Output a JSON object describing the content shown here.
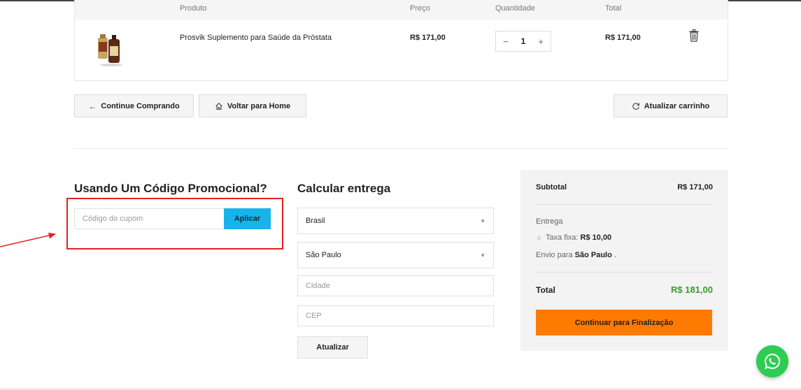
{
  "cart": {
    "headers": {
      "product": "Produto",
      "price": "Preço",
      "quantity": "Quantidade",
      "total": "Total"
    },
    "items": [
      {
        "name": "Prosvik Suplemento para Saúde da Próstata",
        "price": "R$ 171,00",
        "quantity": "1",
        "total": "R$ 171,00"
      }
    ],
    "qty_minus": "−",
    "qty_plus": "+"
  },
  "actions": {
    "continue_shopping": "Continue Comprando",
    "back_home": "Voltar para Home",
    "update_cart": "Atualizar carrinho"
  },
  "coupon": {
    "heading": "Usando Um Código Promocional?",
    "placeholder": "Código do cupom",
    "apply_label": "Aplicar"
  },
  "shipping_calc": {
    "heading": "Calcular entrega",
    "country": "Brasil",
    "state": "São Paulo",
    "city_placeholder": "Cidade",
    "zip_placeholder": "CEP",
    "update_label": "Atualizar"
  },
  "summary": {
    "subtotal_label": "Subtotal",
    "subtotal_value": "R$ 171,00",
    "shipping_label": "Entrega",
    "flat_rate_label": "Taxa fixa:",
    "flat_rate_value": "R$ 10,00",
    "ship_to_prefix": "Envio para",
    "ship_to_place": "São Paulo",
    "ship_to_suffix": ".",
    "total_label": "Total",
    "total_value": "R$ 181,00",
    "checkout_label": "Continuar para Finalização"
  },
  "colors": {
    "accent_blue": "#16b4e9",
    "checkout_orange": "#ff7a00",
    "total_green": "#3a9b2e",
    "annotation_red": "#e32222",
    "whatsapp_green": "#2ecc52"
  },
  "icons": {
    "back": "arrow-left-icon",
    "home": "home-icon",
    "refresh": "refresh-icon",
    "delete": "trash-icon",
    "whatsapp": "whatsapp-icon"
  }
}
